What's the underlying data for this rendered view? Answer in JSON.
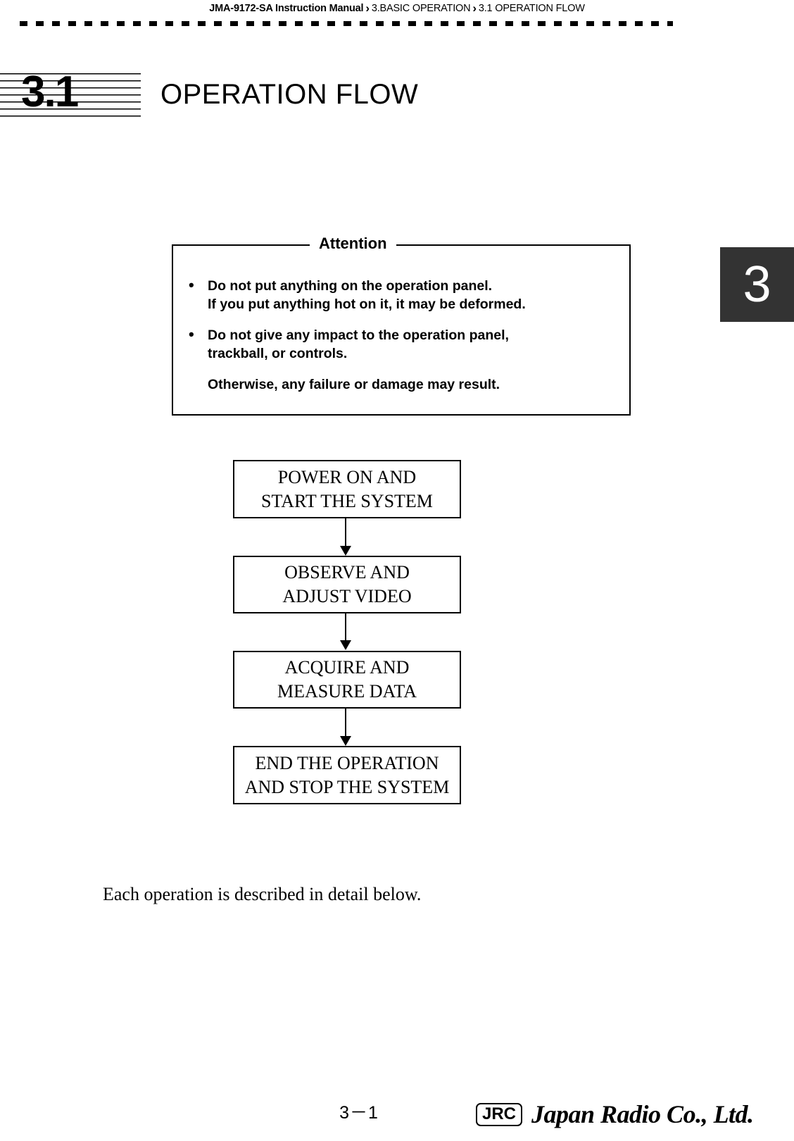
{
  "header": {
    "breadcrumb": {
      "manual": "JMA-9172-SA Instruction Manual",
      "separator": "›",
      "chapter": "3.BASIC OPERATION",
      "section": "3.1  OPERATION FLOW"
    }
  },
  "section": {
    "number": "3.1",
    "title": "OPERATION FLOW"
  },
  "chapter_tab": {
    "label": "3",
    "background_color": "#333333",
    "text_color": "#ffffff"
  },
  "attention": {
    "legend": "Attention",
    "items": [
      {
        "bullet": "•",
        "lines": [
          "Do not put anything on the operation panel.",
          "If you put anything hot on it, it may be deformed."
        ]
      },
      {
        "bullet": "•",
        "lines": [
          "Do not give any impact to the operation panel,",
          "trackball, or controls."
        ]
      }
    ],
    "note": "Otherwise, any failure or damage may result."
  },
  "flowchart": {
    "type": "flow",
    "steps": [
      {
        "line1": "POWER ON AND",
        "line2": "START THE SYSTEM"
      },
      {
        "line1": "OBSERVE AND",
        "line2": "ADJUST VIDEO"
      },
      {
        "line1": "ACQUIRE AND",
        "line2": "MEASURE DATA"
      },
      {
        "line1": "END THE OPERATION",
        "line2": "AND STOP THE SYSTEM"
      }
    ]
  },
  "body": {
    "paragraph": "Each operation is described in detail below."
  },
  "footer": {
    "page_number": "3－1",
    "logo_mark": "JRC",
    "company": "Japan Radio Co., Ltd."
  }
}
